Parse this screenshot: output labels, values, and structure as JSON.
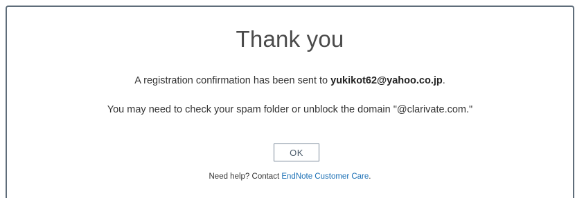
{
  "dialog": {
    "title": "Thank you",
    "confirmation_prefix": "A registration confirmation has been sent to ",
    "email": "yukikot62@yahoo.co.jp",
    "confirmation_suffix": ".",
    "spam_notice": "You may need to check your spam folder or unblock the domain \"@clarivate.com.\"",
    "ok_label": "OK",
    "help_prefix": "Need help? Contact ",
    "help_link": "EndNote Customer Care",
    "help_suffix": "."
  },
  "colors": {
    "link": "#1a6fb5",
    "border": "#5f6d7a"
  }
}
